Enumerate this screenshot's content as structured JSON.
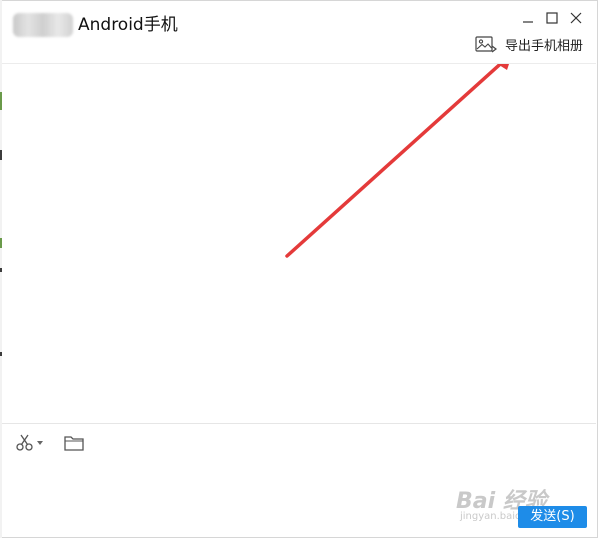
{
  "window": {
    "title": "Android手机",
    "controls": {
      "minimize": "minimize-icon",
      "maximize": "maximize-icon",
      "close": "close-icon"
    }
  },
  "header": {
    "export_album_label": "导出手机相册",
    "export_album_icon": "image-export-icon"
  },
  "toolbar": {
    "screenshot_icon": "scissors-icon",
    "file_icon": "folder-icon"
  },
  "watermark": {
    "main": "Bai 经验",
    "sub": "jingyan.baidu.com"
  },
  "send": {
    "label": "发送(S)"
  },
  "colors": {
    "accent": "#1e8ce8",
    "annotation_arrow": "#e43a3a",
    "divider": "#ececec"
  }
}
